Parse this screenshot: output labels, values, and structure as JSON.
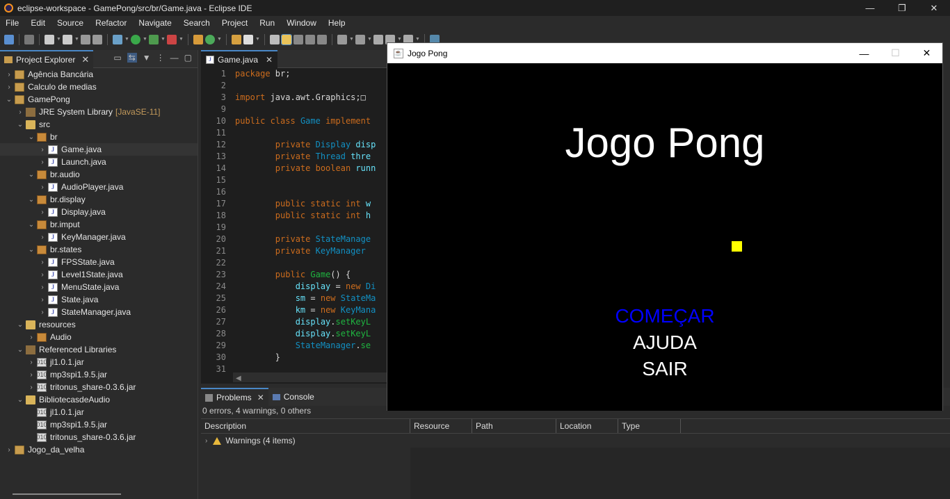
{
  "window": {
    "title": "eclipse-workspace - GamePong/src/br/Game.java - Eclipse IDE"
  },
  "menu": [
    "File",
    "Edit",
    "Source",
    "Refactor",
    "Navigate",
    "Search",
    "Project",
    "Run",
    "Window",
    "Help"
  ],
  "project_explorer": {
    "tab_label": "Project Explorer",
    "items": [
      {
        "label": "Agência Bancária",
        "depth": 0,
        "arrow": "›",
        "icon": "project"
      },
      {
        "label": "Calculo de medias",
        "depth": 0,
        "arrow": "›",
        "icon": "project"
      },
      {
        "label": "GamePong",
        "depth": 0,
        "arrow": "⌄",
        "icon": "project"
      },
      {
        "label": "JRE System Library",
        "decoration": "[JavaSE-11]",
        "depth": 1,
        "arrow": "›",
        "icon": "library"
      },
      {
        "label": "src",
        "depth": 1,
        "arrow": "⌄",
        "icon": "folder"
      },
      {
        "label": "br",
        "depth": 2,
        "arrow": "⌄",
        "icon": "package"
      },
      {
        "label": "Game.java",
        "depth": 3,
        "arrow": "›",
        "icon": "java",
        "selected": true
      },
      {
        "label": "Launch.java",
        "depth": 3,
        "arrow": "›",
        "icon": "java"
      },
      {
        "label": "br.audio",
        "depth": 2,
        "arrow": "⌄",
        "icon": "package"
      },
      {
        "label": "AudioPlayer.java",
        "depth": 3,
        "arrow": "›",
        "icon": "java"
      },
      {
        "label": "br.display",
        "depth": 2,
        "arrow": "⌄",
        "icon": "package"
      },
      {
        "label": "Display.java",
        "depth": 3,
        "arrow": "›",
        "icon": "java"
      },
      {
        "label": "br.imput",
        "depth": 2,
        "arrow": "⌄",
        "icon": "package"
      },
      {
        "label": "KeyManager.java",
        "depth": 3,
        "arrow": "›",
        "icon": "java"
      },
      {
        "label": "br.states",
        "depth": 2,
        "arrow": "⌄",
        "icon": "package"
      },
      {
        "label": "FPSState.java",
        "depth": 3,
        "arrow": "›",
        "icon": "java"
      },
      {
        "label": "Level1State.java",
        "depth": 3,
        "arrow": "›",
        "icon": "java"
      },
      {
        "label": "MenuState.java",
        "depth": 3,
        "arrow": "›",
        "icon": "java"
      },
      {
        "label": "State.java",
        "depth": 3,
        "arrow": "›",
        "icon": "java"
      },
      {
        "label": "StateManager.java",
        "depth": 3,
        "arrow": "›",
        "icon": "java"
      },
      {
        "label": "resources",
        "depth": 1,
        "arrow": "⌄",
        "icon": "folder"
      },
      {
        "label": "Audio",
        "depth": 2,
        "arrow": "›",
        "icon": "package"
      },
      {
        "label": "Referenced Libraries",
        "depth": 1,
        "arrow": "⌄",
        "icon": "library"
      },
      {
        "label": "jl1.0.1.jar",
        "depth": 2,
        "arrow": "›",
        "icon": "jar"
      },
      {
        "label": "mp3spi1.9.5.jar",
        "depth": 2,
        "arrow": "›",
        "icon": "jar"
      },
      {
        "label": "tritonus_share-0.3.6.jar",
        "depth": 2,
        "arrow": "›",
        "icon": "jar"
      },
      {
        "label": "BibliotecasdeAudio",
        "depth": 1,
        "arrow": "⌄",
        "icon": "folder"
      },
      {
        "label": "jl1.0.1.jar",
        "depth": 2,
        "arrow": "",
        "icon": "jar"
      },
      {
        "label": "mp3spi1.9.5.jar",
        "depth": 2,
        "arrow": "",
        "icon": "jar"
      },
      {
        "label": "tritonus_share-0.3.6.jar",
        "depth": 2,
        "arrow": "",
        "icon": "jar"
      },
      {
        "label": "Jogo_da_velha",
        "depth": 0,
        "arrow": "›",
        "icon": "project"
      }
    ]
  },
  "editor": {
    "tab_label": "Game.java",
    "lines": [
      {
        "n": "1",
        "html": "<span class='kw'>package</span> br;"
      },
      {
        "n": "2",
        "html": ""
      },
      {
        "n": "3",
        "html": "<span class='kw'>import</span> java.awt.Graphics;□"
      },
      {
        "n": "9",
        "html": ""
      },
      {
        "n": "10",
        "html": "<span class='kw'>public class</span> <span class='ty'>Game</span> <span class='kw'>implement</span>"
      },
      {
        "n": "11",
        "html": ""
      },
      {
        "n": "12",
        "html": "        <span class='kw'>private</span> <span class='ty'>Display</span> <span class='fld'>disp</span>"
      },
      {
        "n": "13",
        "html": "        <span class='kw'>private</span> <span class='ty'>Thread</span> <span class='fld'>thre</span>"
      },
      {
        "n": "14",
        "html": "        <span class='kw'>private boolean</span> <span class='fld'>runn</span>"
      },
      {
        "n": "15",
        "html": ""
      },
      {
        "n": "16",
        "html": ""
      },
      {
        "n": "17",
        "html": "        <span class='kw'>public static int</span> <span class='fld'>w</span>"
      },
      {
        "n": "18",
        "html": "        <span class='kw'>public static int</span> <span class='fld'>h</span>"
      },
      {
        "n": "19",
        "html": ""
      },
      {
        "n": "20",
        "html": "        <span class='kw'>private</span> <span class='ty'>StateManage</span>"
      },
      {
        "n": "21",
        "html": "        <span class='kw'>private</span> <span class='ty'>KeyManager</span> "
      },
      {
        "n": "22",
        "html": ""
      },
      {
        "n": "23",
        "html": "        <span class='kw'>public</span> <span class='mth'>Game</span>() {"
      },
      {
        "n": "24",
        "html": "            <span class='fld'>display</span> = <span class='kw'>new</span> <span class='ty'>Di</span>"
      },
      {
        "n": "25",
        "html": "            <span class='fld'>sm</span> = <span class='kw'>new</span> <span class='ty'>StateMa</span>"
      },
      {
        "n": "26",
        "html": "            <span class='fld'>km</span> = <span class='kw'>new</span> <span class='ty'>KeyMana</span>"
      },
      {
        "n": "27",
        "html": "            <span class='fld'>display</span>.<span class='mth'>setKeyL</span>"
      },
      {
        "n": "28",
        "html": "            <span class='fld'>display</span>.<span class='mth'>setKeyL</span>"
      },
      {
        "n": "29",
        "html": "            <span class='ty'>StateManager</span>.<span class='mth'>se</span>"
      },
      {
        "n": "30",
        "html": "        }"
      },
      {
        "n": "31",
        "html": ""
      }
    ]
  },
  "game_window": {
    "title": "Jogo Pong",
    "heading": "Jogo Pong",
    "menu_options": [
      {
        "label": "COMEÇAR",
        "color": "#0000ff"
      },
      {
        "label": "AJUDA",
        "color": "#ffffff"
      },
      {
        "label": "SAIR",
        "color": "#ffffff"
      }
    ],
    "ball_color": "#ffff00"
  },
  "problems": {
    "tabs": [
      "Problems",
      "Console"
    ],
    "summary": "0 errors, 4 warnings, 0 others",
    "columns": [
      "Description",
      "Resource",
      "Path",
      "Location",
      "Type"
    ],
    "rows": [
      {
        "label": "Warnings (4 items)"
      }
    ]
  }
}
